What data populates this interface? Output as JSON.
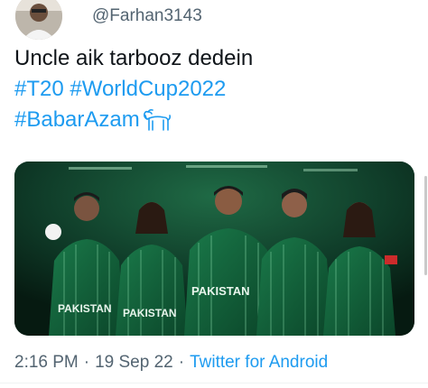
{
  "tweet": {
    "handle": "@Farhan3143",
    "text_line1": "Uncle aik tarbooz dedein",
    "hashtags_line2": "#T20 #WorldCup2022",
    "hashtags_line3": "#BabarAzam",
    "hashtag_emoji_icon": "goat-icon",
    "image_jersey_text": "PAKISTAN",
    "time": "2:16 PM",
    "separator": "·",
    "date": "19 Sep 22",
    "source": "Twitter for Android"
  },
  "colors": {
    "text": "#0f1419",
    "secondary": "#536471",
    "link": "#1d9bf0",
    "jersey_green": "#0f5a35"
  }
}
